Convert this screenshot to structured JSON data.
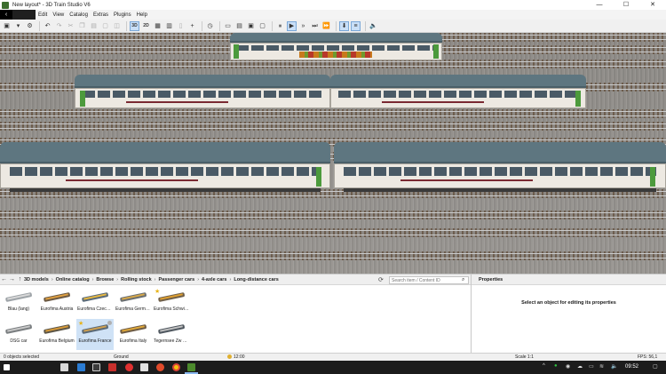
{
  "window": {
    "title": "New layout* - 3D Train Studio V6",
    "minimize": "—",
    "maximize": "☐",
    "close": "✕"
  },
  "menu": {
    "back": "‹",
    "items": [
      "Edit",
      "View",
      "Catalog",
      "Extras",
      "Plugins",
      "Help"
    ]
  },
  "toolbar": {
    "view_3d": "3D",
    "view_2d": "2D"
  },
  "breadcrumb": [
    "3D models",
    "Online catalog",
    "Browse",
    "Rolling stock",
    "Passenger cars",
    "4-axle cars",
    "Long-distance cars"
  ],
  "search": {
    "placeholder": "Search item / Content ID"
  },
  "catalog_items": [
    {
      "label": "Blau (lang)",
      "thumb_color": "#9ea4a8",
      "window_color": "#d8d8d8",
      "star": false,
      "selected": false
    },
    {
      "label": "Eurofima Austria",
      "thumb_color": "#6c5a44",
      "window_color": "#e0a040",
      "star": false,
      "selected": false
    },
    {
      "label": "Eurofima Czech ...",
      "thumb_color": "#5a6b7a",
      "window_color": "#e8b840",
      "star": false,
      "selected": false
    },
    {
      "label": "Eurofima Germany",
      "thumb_color": "#6a6f72",
      "window_color": "#d8a848",
      "star": false,
      "selected": false
    },
    {
      "label": "Eurofima Schwiz...",
      "thumb_color": "#70604a",
      "window_color": "#e0a030",
      "star": true,
      "selected": false
    },
    {
      "label": "DSG car",
      "thumb_color": "#7a7e80",
      "window_color": "#c8c8c8",
      "star": false,
      "selected": false
    },
    {
      "label": "Eurofima Belgium",
      "thumb_color": "#5c5648",
      "window_color": "#d89a38",
      "star": false,
      "selected": false
    },
    {
      "label": "Eurofima France",
      "thumb_color": "#5a6a78",
      "window_color": "#d0a050",
      "star": true,
      "selected": true
    },
    {
      "label": "Eurofima Italy",
      "thumb_color": "#6e5c46",
      "window_color": "#e0a838",
      "star": false,
      "selected": false
    },
    {
      "label": "Tegernsee Zw Kl...",
      "thumb_color": "#505860",
      "window_color": "#c0c0c0",
      "star": false,
      "selected": false
    }
  ],
  "properties": {
    "title": "Properties",
    "message": "Select an object for editing its properties"
  },
  "status": {
    "selection": "0 objects selected",
    "layer": "Ground",
    "time": "12:00",
    "scale": "Scale 1:1",
    "fps": "FPS: 56,1"
  },
  "taskbar": {
    "clock": "09:52"
  }
}
